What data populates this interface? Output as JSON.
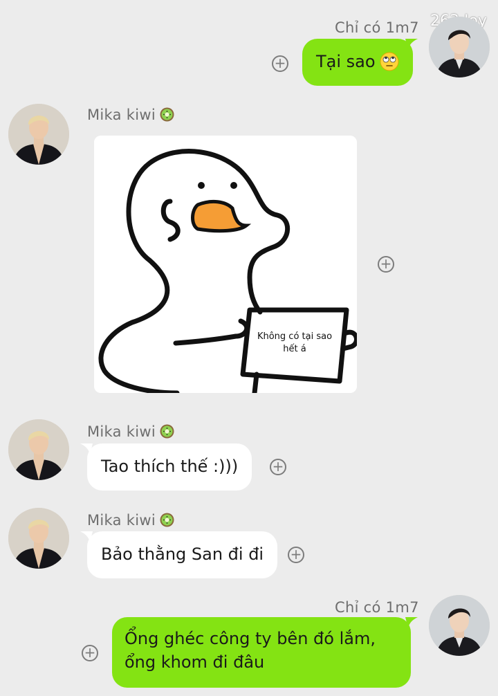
{
  "watermark": "263 Joy",
  "messages": [
    {
      "sender": "Chỉ có 1m7",
      "text": "Tại sao",
      "emoji": "face-with-rolling-eyes"
    },
    {
      "sender": "Mika kiwi",
      "sticker_note_line1": "Không có tại sao",
      "sticker_note_line2": "hết á"
    },
    {
      "sender": "Mika kiwi",
      "text": "Tao thích thế :)))"
    },
    {
      "sender": "Mika kiwi",
      "text": "Bảo thằng San đi đi"
    },
    {
      "sender": "Chỉ có 1m7",
      "text_line1": "Ổng ghéc công ty bên đó lắm,",
      "text_line2": "ổng khom đi đâu"
    }
  ],
  "colors": {
    "background": "#ececec",
    "outgoing_bubble": "#84e313",
    "incoming_bubble": "#ffffff"
  },
  "icons": {
    "add_reaction": "plus-circle-icon",
    "name_badge": "kiwi-icon"
  }
}
